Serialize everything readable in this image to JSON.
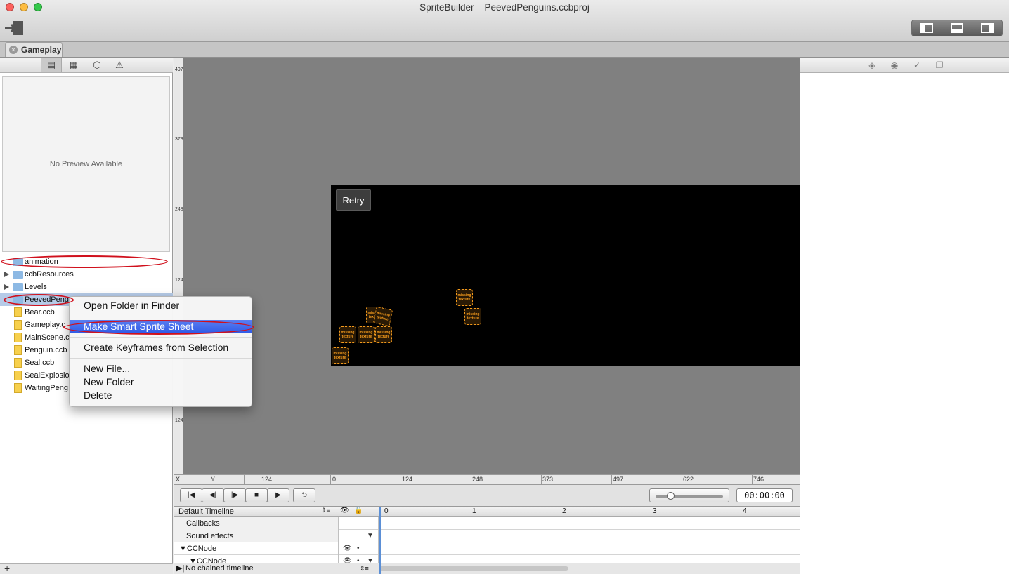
{
  "window": {
    "title": "SpriteBuilder – PeevedPenguins.ccbproj"
  },
  "tabs": [
    {
      "label": "Gameplay"
    }
  ],
  "left_panel": {
    "preview_text": "No Preview Available",
    "tree": [
      {
        "label": "animation",
        "kind": "folder",
        "expanded": false,
        "selected": false
      },
      {
        "label": "ccbResources",
        "kind": "folder",
        "expanded": false,
        "selected": false
      },
      {
        "label": "Levels",
        "kind": "folder",
        "expanded": false,
        "selected": false
      },
      {
        "label": "PeevedPeng",
        "kind": "folder",
        "expanded": false,
        "selected": true
      },
      {
        "label": "Bear.ccb",
        "kind": "file"
      },
      {
        "label": "Gameplay.c",
        "kind": "file"
      },
      {
        "label": "MainScene.c",
        "kind": "file"
      },
      {
        "label": "Penguin.ccb",
        "kind": "file"
      },
      {
        "label": "Seal.ccb",
        "kind": "file"
      },
      {
        "label": "SealExplosio",
        "kind": "file"
      },
      {
        "label": "WaitingPeng",
        "kind": "file"
      }
    ],
    "add_label": "+"
  },
  "context_menu": {
    "items": [
      {
        "label": "Open Folder in Finder"
      },
      {
        "label": "Make Smart Sprite Sheet",
        "highlighted": true
      },
      {
        "label": "Create Keyframes from Selection"
      },
      {
        "label": "New File..."
      },
      {
        "label": "New Folder"
      },
      {
        "label": "Delete"
      }
    ]
  },
  "canvas": {
    "retry_label": "Retry",
    "missing_texture_text": "missing texture",
    "vruler_labels": [
      "497",
      "373",
      "248",
      "124",
      "124"
    ]
  },
  "hruler": {
    "x_label": "X",
    "y_label": "Y",
    "labels": [
      "124",
      "0",
      "124",
      "248",
      "373",
      "497",
      "622",
      "746"
    ]
  },
  "transport": {
    "buttons": [
      "rewind",
      "step-back",
      "step-forward",
      "stop",
      "play",
      "loop"
    ],
    "timecode": "00:00:00"
  },
  "timeline": {
    "name": "Default Timeline",
    "ticks": [
      "0",
      "1",
      "2",
      "3",
      "4"
    ],
    "rows": [
      {
        "label": "Callbacks"
      },
      {
        "label": "Sound effects"
      },
      {
        "label": "CCNode"
      },
      {
        "label": "CCNode"
      }
    ],
    "footer": "No chained timeline"
  },
  "colors": {
    "accent": "#2f5ae6",
    "annotation": "#d0101c",
    "missing_texture": "#f39a1c"
  }
}
